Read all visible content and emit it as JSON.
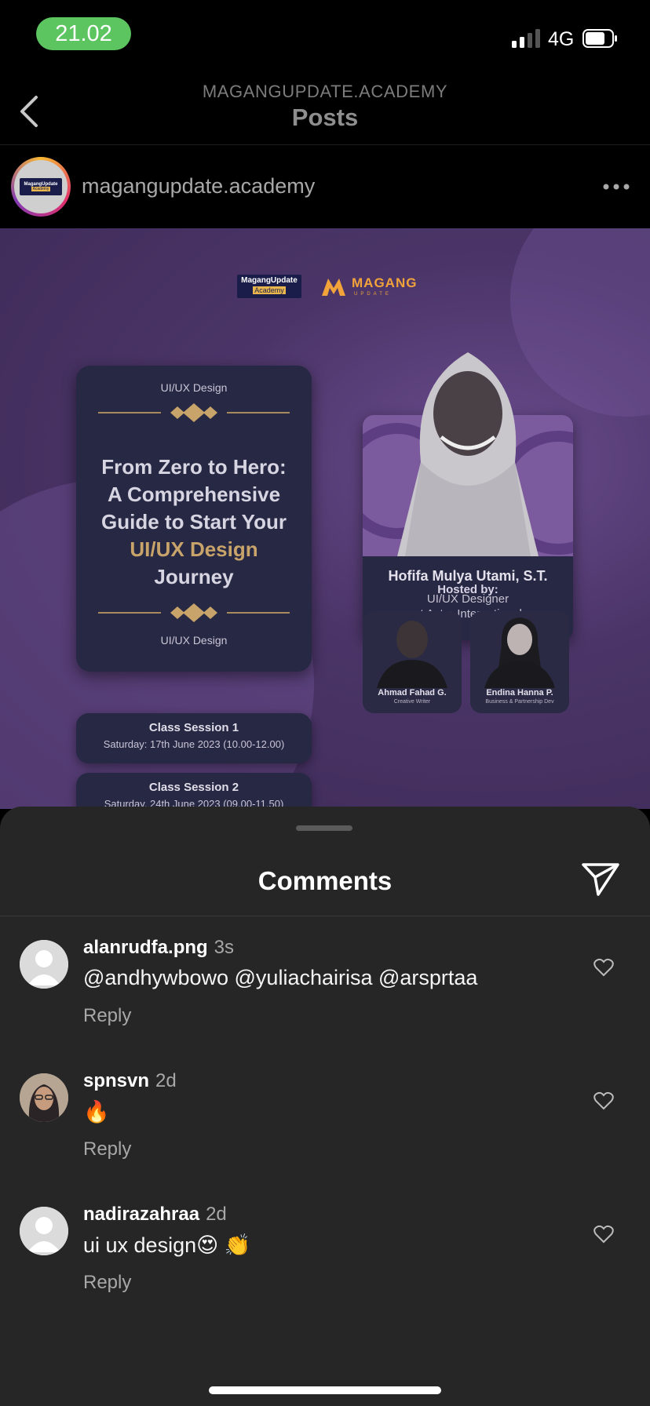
{
  "status": {
    "time": "21.02",
    "network": "4G"
  },
  "nav": {
    "subtitle": "MAGANGUPDATE.ACADEMY",
    "title": "Posts"
  },
  "post": {
    "username": "magangupdate.academy",
    "avatar_logo": {
      "line1": "MagangUpdate",
      "line2": "Academy"
    },
    "image": {
      "logo_a": {
        "line1": "MagangUpdate",
        "line2": "Academy"
      },
      "logo_m": {
        "name": "MAGANG",
        "sub": "UPDATE"
      },
      "tag_top": "UI/UX Design",
      "title_lines": [
        "From Zero to Hero:",
        "A Comprehensive",
        "Guide to Start Your"
      ],
      "title_gold": "UI/UX Design",
      "title_last": "Journey",
      "tag_bottom": "UI/UX Design",
      "speaker": {
        "name": "Hofifa Mulya Utami, S.T.",
        "role1": "UI/UX Designer",
        "role2": "at Astra International"
      },
      "hosted_by": "Hosted by:",
      "hosts": [
        {
          "name": "Ahmad Fahad G.",
          "role": "Creative Writer"
        },
        {
          "name": "Endina Hanna P.",
          "role": "Business & Partnership Dev"
        }
      ],
      "sessions": [
        {
          "label": "Class Session 1",
          "date": "Saturday: 17th June 2023 (10.00-12.00)"
        },
        {
          "label": "Class Session 2",
          "date": "Saturday, 24th June 2023 (09.00-11.50)"
        }
      ]
    }
  },
  "comments_sheet": {
    "title": "Comments",
    "reply_label": "Reply",
    "items": [
      {
        "user": "alanrudfa.png",
        "time": "3s",
        "text": "@andhywbowo @yuliachairisa @arsprtaa"
      },
      {
        "user": "spnsvn",
        "time": "2d",
        "text": "🔥"
      },
      {
        "user": "nadirazahraa",
        "time": "2d",
        "text": "ui ux design😍 👏"
      }
    ]
  },
  "colors": {
    "time_pill": "#5cc560",
    "sheet_bg": "#262626",
    "post_bg": "#3d2a57",
    "gold": "#c9a46a"
  }
}
